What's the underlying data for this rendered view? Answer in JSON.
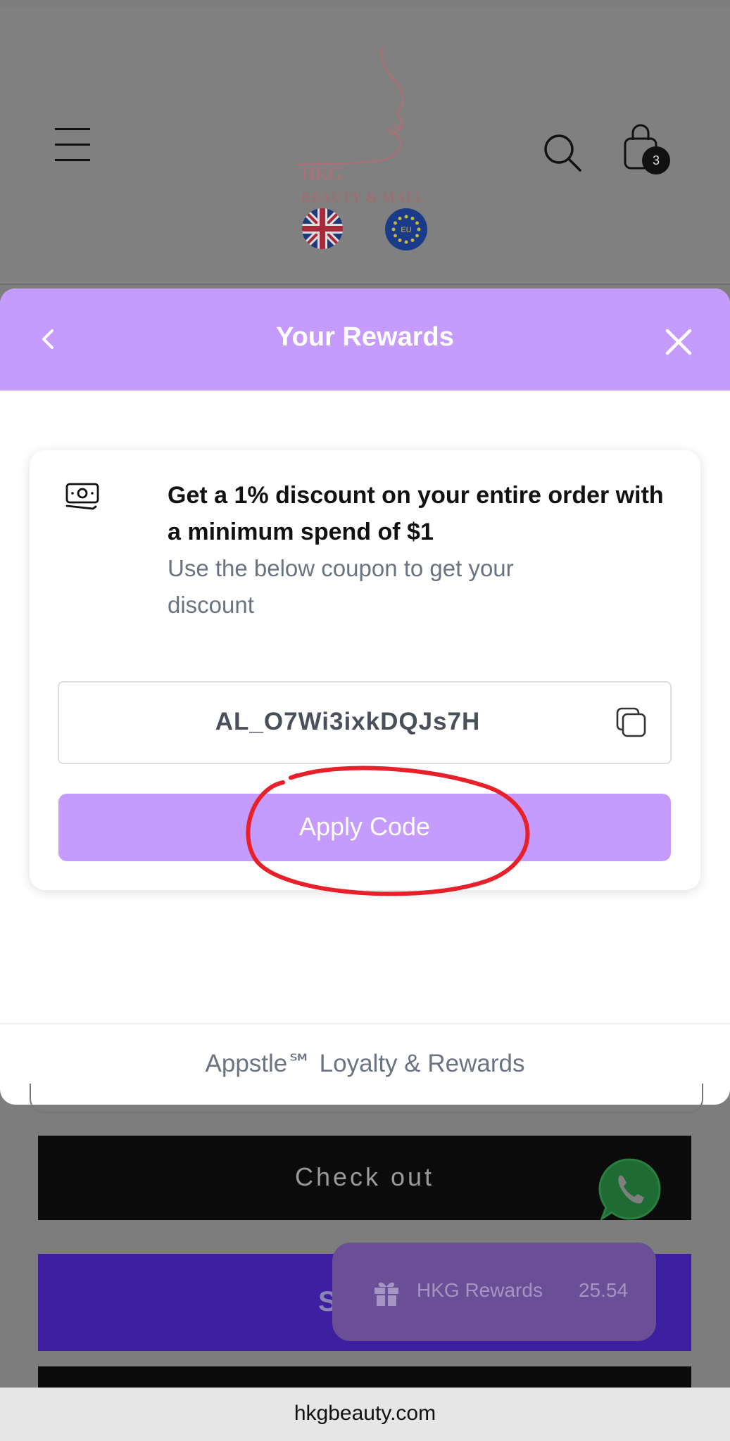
{
  "header": {
    "logo_line1": "HKG",
    "logo_line2": "BEAUTY & MALL",
    "cart_count": "3",
    "flag_eu_text": "EU"
  },
  "modal": {
    "title": "Your Rewards",
    "reward": {
      "title": "Get a 1% discount on your entire order with a minimum spend of $1",
      "description": "Use the below coupon to get your discount",
      "coupon_code": "AL_O7Wi3ixkDQJs7H",
      "apply_label": "Apply Code"
    },
    "footer": "Appstle℠ Loyalty & Rewards"
  },
  "page": {
    "checkout_label": "Check out",
    "shop_label_visible": "S"
  },
  "rewards_pill": {
    "label": "HKG Rewards",
    "points": "25.54"
  },
  "browser": {
    "url": "hkgbeauty.com"
  },
  "colors": {
    "accent": "#c59bfd",
    "annotation": "#e8202a"
  }
}
